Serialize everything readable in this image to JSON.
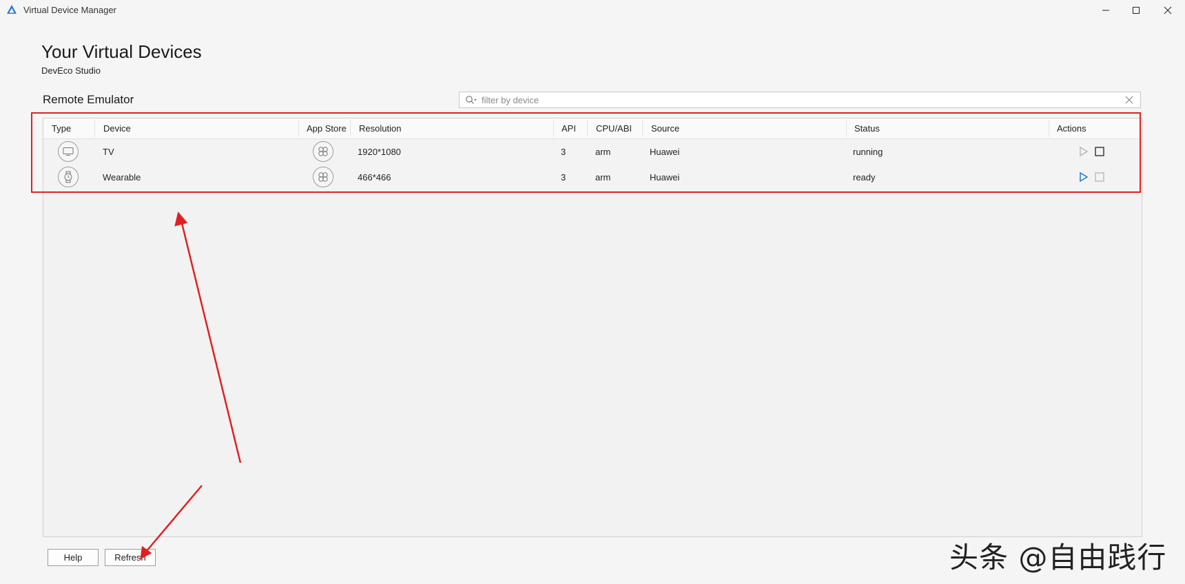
{
  "window": {
    "title": "Virtual Device Manager",
    "logo_icon": "deveco-logo-icon",
    "controls": [
      "minimize-icon",
      "maximize-icon",
      "close-icon"
    ]
  },
  "header": {
    "title": "Your Virtual Devices",
    "subtitle": "DevEco Studio"
  },
  "section": {
    "title": "Remote Emulator"
  },
  "search": {
    "placeholder": "filter by device",
    "value": ""
  },
  "table": {
    "columns": [
      "Type",
      "Device",
      "App Store",
      "Resolution",
      "API",
      "CPU/ABI",
      "Source",
      "Status",
      "Actions"
    ],
    "rows": [
      {
        "type_icon": "tv-icon",
        "device": "TV",
        "app_store_icon": "app-store-icon",
        "resolution": "1920*1080",
        "api": "3",
        "cpu": "arm",
        "source": "Huawei",
        "status": "running",
        "play_enabled": false,
        "stop_enabled": true
      },
      {
        "type_icon": "watch-icon",
        "device": "Wearable",
        "app_store_icon": "app-store-icon",
        "resolution": "466*466",
        "api": "3",
        "cpu": "arm",
        "source": "Huawei",
        "status": "ready",
        "play_enabled": true,
        "stop_enabled": false
      }
    ]
  },
  "footer": {
    "help_label": "Help",
    "refresh_label": "Refresh"
  },
  "watermark": "头条 @自由践行",
  "colors": {
    "annotation_red": "#e02020",
    "play_active": "#1e7ad6",
    "background": "#f5f5f5"
  }
}
